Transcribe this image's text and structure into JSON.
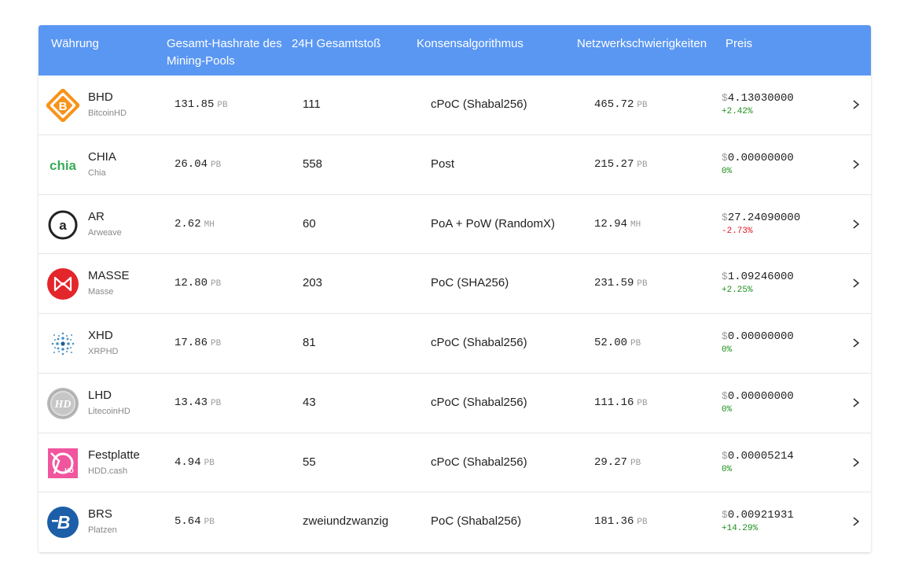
{
  "header": {
    "currency": "Währung",
    "hashrate": "Gesamt-Hashrate des Mining-Pools",
    "impact": "24H Gesamtstoß",
    "consensus": "Konsensalgorithmus",
    "difficulty": "Netzwerkschwierigkeiten",
    "price": "Preis"
  },
  "colors": {
    "header_bg": "#5a97f2",
    "positive": "#1a8f1a",
    "negative": "#e0151b"
  },
  "rows": [
    {
      "symbol": "BHD",
      "name": "BitcoinHD",
      "icon": "bitcoinhd-icon",
      "hashrate": "131.85",
      "hash_unit": "PB",
      "impact": "111",
      "algorithm": "cPoC (Shabal256)",
      "difficulty": "465.72",
      "diff_unit": "PB",
      "currency_sign": "$",
      "price": "4.13030000",
      "change": "+2.42%",
      "change_dir": "up"
    },
    {
      "symbol": "CHIA",
      "name": "Chia",
      "icon": "chia-icon",
      "hashrate": "26.04",
      "hash_unit": "PB",
      "impact": "558",
      "algorithm": "Post",
      "difficulty": "215.27",
      "diff_unit": "PB",
      "currency_sign": "$",
      "price": "0.00000000",
      "change": "0%",
      "change_dir": "up"
    },
    {
      "symbol": "AR",
      "name": "Arweave",
      "icon": "arweave-icon",
      "hashrate": "2.62",
      "hash_unit": "MH",
      "impact": "60",
      "algorithm": "PoA + PoW (RandomX)",
      "difficulty": "12.94",
      "diff_unit": "MH",
      "currency_sign": "$",
      "price": "27.24090000",
      "change": "-2.73%",
      "change_dir": "down"
    },
    {
      "symbol": "MASSE",
      "name": "Masse",
      "icon": "massnet-icon",
      "hashrate": "12.80",
      "hash_unit": "PB",
      "impact": "203",
      "algorithm": "PoC (SHA256)",
      "difficulty": "231.59",
      "diff_unit": "PB",
      "currency_sign": "$",
      "price": "1.09246000",
      "change": "+2.25%",
      "change_dir": "up"
    },
    {
      "symbol": "XHD",
      "name": "XRPHD",
      "icon": "xrphd-icon",
      "hashrate": "17.86",
      "hash_unit": "PB",
      "impact": "81",
      "algorithm": "cPoC (Shabal256)",
      "difficulty": "52.00",
      "diff_unit": "PB",
      "currency_sign": "$",
      "price": "0.00000000",
      "change": "0%",
      "change_dir": "up"
    },
    {
      "symbol": "LHD",
      "name": "LitecoinHD",
      "icon": "litecoinhd-icon",
      "hashrate": "13.43",
      "hash_unit": "PB",
      "impact": "43",
      "algorithm": "cPoC (Shabal256)",
      "difficulty": "111.16",
      "diff_unit": "PB",
      "currency_sign": "$",
      "price": "0.00000000",
      "change": "0%",
      "change_dir": "up"
    },
    {
      "symbol": "Festplatte",
      "name": "HDD.cash",
      "icon": "hddcash-icon",
      "hashrate": "4.94",
      "hash_unit": "PB",
      "impact": "55",
      "algorithm": "cPoC (Shabal256)",
      "difficulty": "29.27",
      "diff_unit": "PB",
      "currency_sign": "$",
      "price": "0.00005214",
      "change": "0%",
      "change_dir": "up"
    },
    {
      "symbol": "BRS",
      "name": "Platzen",
      "icon": "burst-icon",
      "hashrate": "5.64",
      "hash_unit": "PB",
      "impact": "zweiundzwanzig",
      "algorithm": "PoC (Shabal256)",
      "difficulty": "181.36",
      "diff_unit": "PB",
      "currency_sign": "$",
      "price": "0.00921931",
      "change": "+14.29%",
      "change_dir": "up"
    }
  ]
}
